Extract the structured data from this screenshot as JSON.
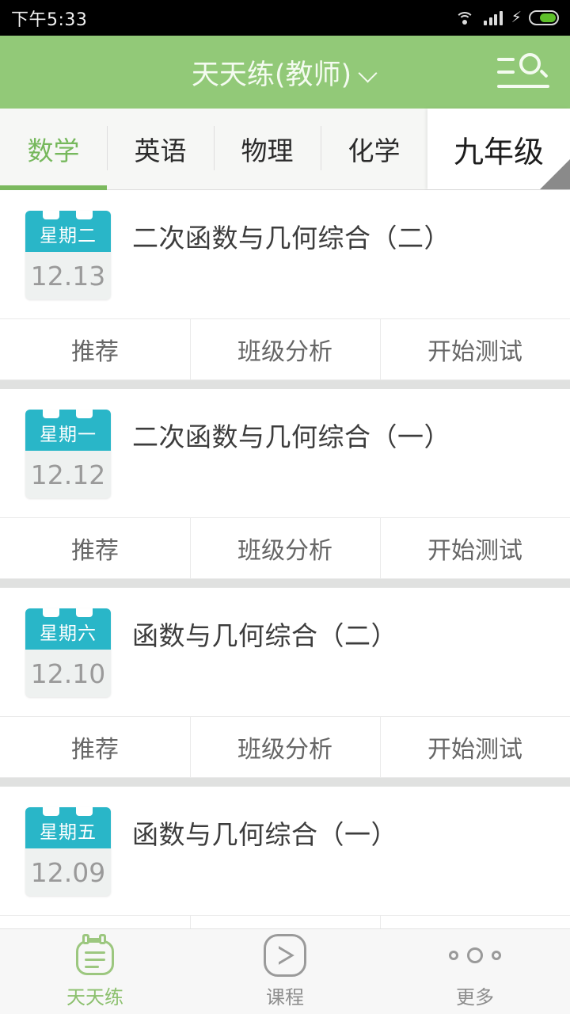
{
  "status_bar": {
    "time": "下午5:33",
    "icons": [
      "wifi-icon",
      "signal-icon",
      "charging-bolt-icon",
      "battery-icon"
    ]
  },
  "app_bar": {
    "title": "天天练(教师)",
    "dropdown_icon": "chevron-down-icon",
    "search_icon": "list-search-icon",
    "background_color": "#92c978"
  },
  "tabs": [
    {
      "label": "数学",
      "active": true
    },
    {
      "label": "英语",
      "active": false
    },
    {
      "label": "物理",
      "active": false
    },
    {
      "label": "化学",
      "active": false
    }
  ],
  "grade_selector": {
    "label": "九年级"
  },
  "actions": {
    "recommend": "推荐",
    "class_analysis": "班级分析",
    "start_test": "开始测试"
  },
  "cards": [
    {
      "weekday": "星期二",
      "date": "12.13",
      "title": "二次函数与几何综合（二）"
    },
    {
      "weekday": "星期一",
      "date": "12.12",
      "title": "二次函数与几何综合（一）"
    },
    {
      "weekday": "星期六",
      "date": "12.10",
      "title": "函数与几何综合（二）"
    },
    {
      "weekday": "星期五",
      "date": "12.09",
      "title": "函数与几何综合（一）"
    }
  ],
  "bottom_nav": [
    {
      "label": "天天练",
      "icon": "notebook-icon",
      "active": true
    },
    {
      "label": "课程",
      "icon": "play-icon",
      "active": false
    },
    {
      "label": "更多",
      "icon": "more-dots-icon",
      "active": false
    }
  ],
  "colors": {
    "brand_green": "#92c978",
    "accent_teal": "#29b6c8",
    "active_tab_green": "#76b85c"
  }
}
